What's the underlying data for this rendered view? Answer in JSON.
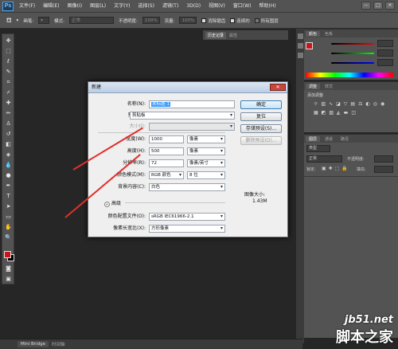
{
  "app": {
    "logo": "Ps"
  },
  "menu": [
    "文件(F)",
    "编辑(E)",
    "图像(I)",
    "图层(L)",
    "文字(Y)",
    "选择(S)",
    "滤镜(T)",
    "3D(D)",
    "视图(V)",
    "窗口(W)",
    "帮助(H)"
  ],
  "window_buttons": [
    "—",
    "□",
    "✕"
  ],
  "options_bar": {
    "preset_label": "画笔:",
    "mode_label": "模式:",
    "mode_value": "正常",
    "opacity_label": "不透明度:",
    "opacity_value": "100%",
    "flow_label": "流量:",
    "flow_value": "100%",
    "check1": "消除锯齿",
    "check2": "连续的",
    "check3": "所有图层"
  },
  "history_panel": {
    "tab1": "历史记录",
    "tab2": "属性"
  },
  "color_panel": {
    "tabs": [
      "颜色",
      "色板"
    ]
  },
  "adjust_panel": {
    "tabs": [
      "调整",
      "样式"
    ],
    "label": "添加调整"
  },
  "layers_panel": {
    "tabs": [
      "图层",
      "通道",
      "路径"
    ],
    "kind": "类型",
    "blend": "正常",
    "opacity_label": "不透明度:",
    "lock_label": "锁定:",
    "fill_label": "填充:"
  },
  "status_bar": {
    "tab1": "Mini Bridge",
    "tab2": "时间轴"
  },
  "dialog": {
    "title": "新建",
    "close": "✕",
    "fields": {
      "name_label": "名称(N):",
      "name_value": "未标题-1",
      "preset_label": "预设(P):",
      "preset_value": "剪贴板",
      "size_label": "大小(I):",
      "width_label": "宽度(W):",
      "width_value": "1000",
      "width_unit": "像素",
      "height_label": "高度(H):",
      "height_value": "500",
      "height_unit": "像素",
      "res_label": "分辨率(R):",
      "res_value": "72",
      "res_unit": "像素/英寸",
      "mode_label": "颜色模式(M):",
      "mode_value": "RGB 颜色",
      "mode_bits": "8 位",
      "bg_label": "背景内容(C):",
      "bg_value": "白色",
      "advanced": "高级",
      "profile_label": "颜色配置文件(O):",
      "profile_value": "sRGB IEC61966-2.1",
      "aspect_label": "像素长宽比(X):",
      "aspect_value": "方形像素"
    },
    "buttons": {
      "ok": "确定",
      "reset": "复位",
      "save_preset": "存储预设(S)...",
      "delete_preset": "删除预设(D)..."
    },
    "image_size_label": "图像大小:",
    "image_size_value": "1.43M"
  },
  "watermark": {
    "site": "jb51.net",
    "name": "脚本之家"
  },
  "colors": {
    "foreground": "#c8151b",
    "background": "#000000",
    "arrow": "#e0302a",
    "accent": "#3399ff"
  }
}
